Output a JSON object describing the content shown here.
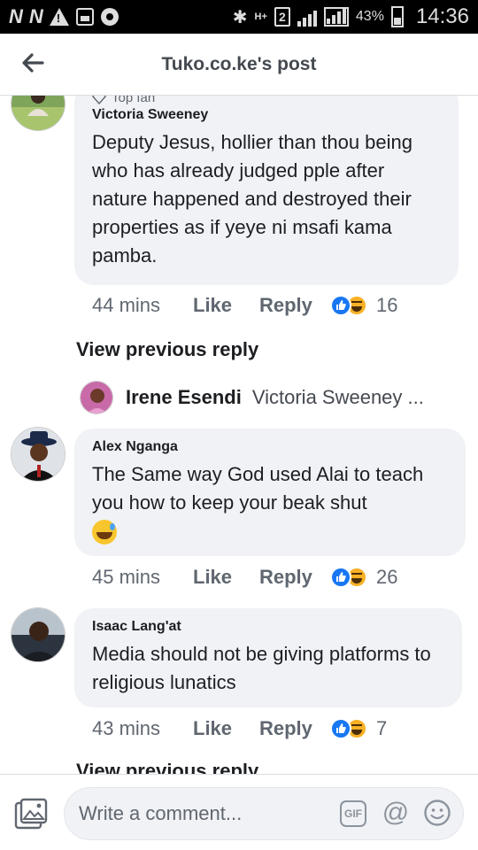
{
  "status_bar": {
    "carrier_icons": [
      "N",
      "N"
    ],
    "network": "H+",
    "sim": "2",
    "battery_pct": "43%",
    "time": "14:36"
  },
  "header": {
    "title": "Tuko.co.ke's post"
  },
  "comments": [
    {
      "badge": "Top fan",
      "author": "Victoria Sweeney",
      "text": "Deputy Jesus, hollier than thou being who has already judged pple after nature happened and destroyed their properties as if yeye ni msafi kama pamba.",
      "time": "44 mins",
      "reaction_count": "16"
    },
    {
      "author": "Alex Nganga",
      "text": "The Same way God used Alai to teach you how to keep your beak shut",
      "time": "45 mins",
      "reaction_count": "26"
    },
    {
      "author": "Isaac Lang'at",
      "text": "Media should not be giving platforms to religious lunatics",
      "time": "43 mins",
      "reaction_count": "7"
    }
  ],
  "actions": {
    "like": "Like",
    "reply": "Reply"
  },
  "view_previous_reply": "View previous reply",
  "reply_preview": {
    "author": "Irene Esendi",
    "text": "Victoria Sweeney ..."
  },
  "composer": {
    "placeholder": "Write a comment...",
    "gif_label": "GIF"
  },
  "colors": {
    "bubble": "#f0f2f5",
    "like_blue": "#1877f2",
    "haha_yellow": "#f7b125"
  }
}
